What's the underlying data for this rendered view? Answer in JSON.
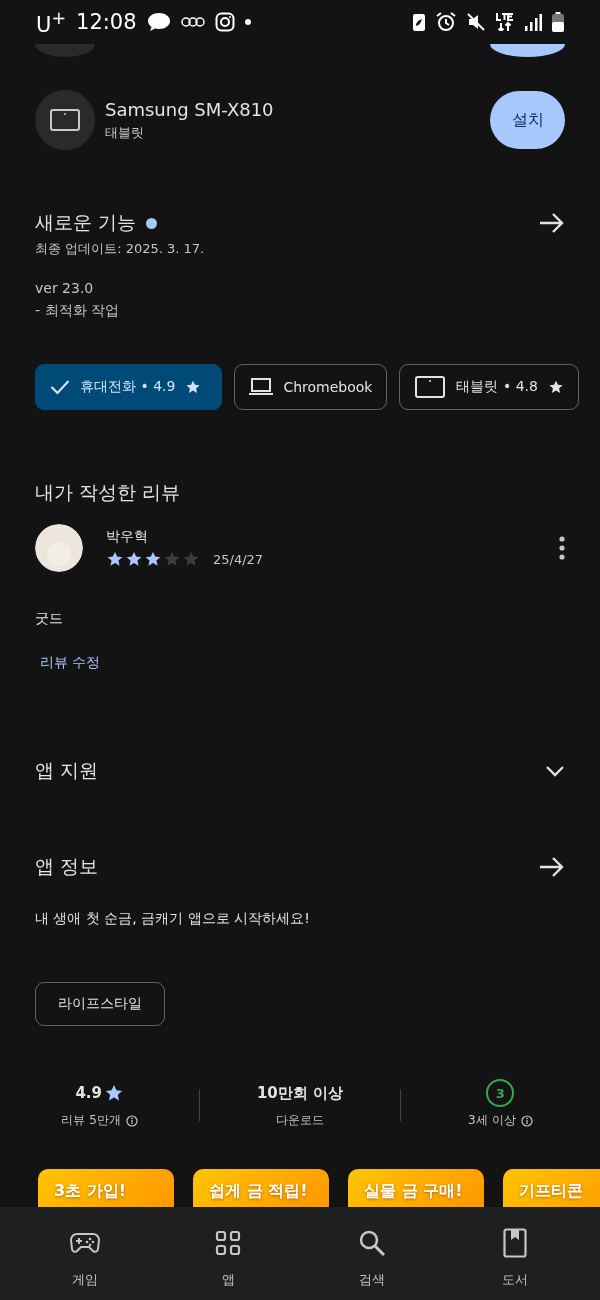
{
  "status_bar": {
    "carrier": "U$^{+}$",
    "time": "12:08"
  },
  "devices": [
    {
      "kind": "cut"
    },
    {
      "kind": "tablet",
      "name": "Samsung SM-X810",
      "type": "태블릿",
      "button": "설치"
    }
  ],
  "whats_new": {
    "title": "새로운 기능",
    "new_dot": true,
    "updated": "최종 업데이트: 2025. 3. 17.",
    "notes": [
      "ver 23.0",
      "- 최적화 작업"
    ]
  },
  "device_chips": [
    {
      "label": "휴대전화 • 4.9",
      "star": true,
      "selected": true
    },
    {
      "kind": "laptop",
      "label": "Chromebook",
      "star": false,
      "selected": false
    },
    {
      "kind": "tablet",
      "label": "태블릿 • 4.8",
      "star": true,
      "selected": false
    }
  ],
  "my_review": {
    "title": "내가 작성한 리뷰",
    "name": "박우혁",
    "stars": 3,
    "date": "25/4/27",
    "text": "굿드",
    "edit": "리뷰 수정"
  },
  "app_support": {
    "title": "앱 지원",
    "expanded": false
  },
  "app_info": {
    "title": "앱 정보",
    "description": "내 생애 첫 순금, 금캐기 앱으로 시작하세요!",
    "tags": [
      "라이프스타일"
    ]
  },
  "stats": [
    {
      "kind": "rating",
      "value": "4.9",
      "label": "리뷰 5만개",
      "info": true
    },
    {
      "kind": "text",
      "value": "10만회 이상",
      "label": "다운로드",
      "info": false
    },
    {
      "kind": "age",
      "value": "3",
      "label": "3세 이상",
      "info": true
    }
  ],
  "screenshots": [
    {
      "caption": "3초 가입!"
    },
    {
      "caption": "쉽게 금 적립!"
    },
    {
      "caption": "실물 금 구매!"
    },
    {
      "caption": "기프티콘"
    }
  ],
  "nav": [
    {
      "kind": "games",
      "label": "게임",
      "selected": false
    },
    {
      "kind": "apps",
      "label": "앱",
      "selected": false
    },
    {
      "kind": "search",
      "label": "검색",
      "selected": false
    },
    {
      "kind": "books",
      "label": "도서",
      "selected": false
    }
  ]
}
